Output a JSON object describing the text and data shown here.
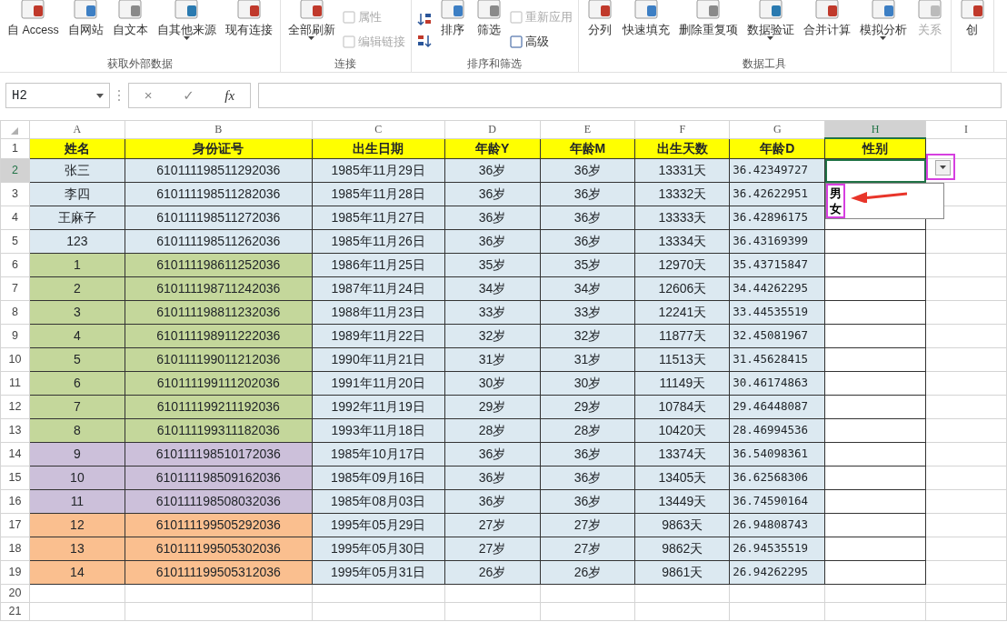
{
  "ribbon": {
    "groups": [
      {
        "label": "获取外部数据",
        "items": [
          {
            "kind": "large",
            "label": "自 Access",
            "dropdown": false,
            "disabled": false
          },
          {
            "kind": "large",
            "label": "自网站",
            "dropdown": false,
            "disabled": false
          },
          {
            "kind": "large",
            "label": "自文本",
            "dropdown": false,
            "disabled": false
          },
          {
            "kind": "large",
            "label": "自其他来源",
            "dropdown": true,
            "disabled": false
          },
          {
            "kind": "large",
            "label": "现有连接",
            "dropdown": false,
            "disabled": false
          }
        ]
      },
      {
        "label": "连接",
        "items": [
          {
            "kind": "large",
            "label": "全部刷新",
            "dropdown": true,
            "disabled": false
          },
          {
            "kind": "stack",
            "items": [
              {
                "label": "属性",
                "disabled": true
              },
              {
                "label": "编辑链接",
                "disabled": true
              }
            ]
          }
        ]
      },
      {
        "label": "排序和筛选",
        "items": [
          {
            "kind": "sort"
          },
          {
            "kind": "large",
            "label": "排序",
            "dropdown": false,
            "disabled": false
          },
          {
            "kind": "large",
            "label": "筛选",
            "dropdown": false,
            "disabled": false
          },
          {
            "kind": "stack",
            "items": [
              {
                "label": "重新应用",
                "disabled": true
              },
              {
                "label": "高级",
                "disabled": false
              }
            ]
          }
        ]
      },
      {
        "label": "数据工具",
        "items": [
          {
            "kind": "large",
            "label": "分列",
            "dropdown": false,
            "disabled": false
          },
          {
            "kind": "large",
            "label": "快速填充",
            "dropdown": false,
            "disabled": false
          },
          {
            "kind": "large",
            "label": "删除重复项",
            "dropdown": false,
            "disabled": false
          },
          {
            "kind": "large",
            "label": "数据验证",
            "dropdown": true,
            "disabled": false
          },
          {
            "kind": "large",
            "label": "合并计算",
            "dropdown": false,
            "disabled": false
          },
          {
            "kind": "large",
            "label": "模拟分析",
            "dropdown": true,
            "disabled": false
          },
          {
            "kind": "large",
            "label": "关系",
            "dropdown": false,
            "disabled": true
          }
        ]
      },
      {
        "items": [
          {
            "kind": "large",
            "label": "创",
            "dropdown": false,
            "disabled": false
          }
        ]
      }
    ]
  },
  "formula_bar": {
    "name_box": "H2",
    "buttons": [
      "×",
      "✓",
      "fx"
    ]
  },
  "sheet": {
    "columns": [
      {
        "label": "A",
        "selected": false
      },
      {
        "label": "B",
        "selected": false
      },
      {
        "label": "C",
        "selected": false
      },
      {
        "label": "D",
        "selected": false
      },
      {
        "label": "E",
        "selected": false
      },
      {
        "label": "F",
        "selected": false
      },
      {
        "label": "G",
        "selected": false
      },
      {
        "label": "H",
        "selected": true
      },
      {
        "label": "I",
        "selected": false
      }
    ],
    "header_row": {
      "number": "1",
      "cells": [
        "姓名",
        "身份证号",
        "出生日期",
        "年龄Y",
        "年龄M",
        "出生天数",
        "年龄D",
        "性别"
      ]
    },
    "rows": [
      {
        "number": "2",
        "selected": true,
        "color": "#dce9f1",
        "cells": [
          "张三",
          "610111198511292036",
          "1985年11月29日",
          "36岁",
          "36岁",
          "13331天",
          "36.42349727"
        ]
      },
      {
        "number": "3",
        "selected": false,
        "color": "#dce9f1",
        "cells": [
          "李四",
          "610111198511282036",
          "1985年11月28日",
          "36岁",
          "36岁",
          "13332天",
          "36.42622951"
        ]
      },
      {
        "number": "4",
        "selected": false,
        "color": "#dce9f1",
        "cells": [
          "王麻子",
          "610111198511272036",
          "1985年11月27日",
          "36岁",
          "36岁",
          "13333天",
          "36.42896175"
        ]
      },
      {
        "number": "5",
        "selected": false,
        "color": "#dce9f1",
        "cells": [
          "123",
          "610111198511262036",
          "1985年11月26日",
          "36岁",
          "36岁",
          "13334天",
          "36.43169399"
        ]
      },
      {
        "number": "6",
        "selected": false,
        "color": "#c4d79b",
        "cells": [
          "1",
          "610111198611252036",
          "1986年11月25日",
          "35岁",
          "35岁",
          "12970天",
          "35.43715847"
        ]
      },
      {
        "number": "7",
        "selected": false,
        "color": "#c4d79b",
        "cells": [
          "2",
          "610111198711242036",
          "1987年11月24日",
          "34岁",
          "34岁",
          "12606天",
          "34.44262295"
        ]
      },
      {
        "number": "8",
        "selected": false,
        "color": "#c4d79b",
        "cells": [
          "3",
          "610111198811232036",
          "1988年11月23日",
          "33岁",
          "33岁",
          "12241天",
          "33.44535519"
        ]
      },
      {
        "number": "9",
        "selected": false,
        "color": "#c4d79b",
        "cells": [
          "4",
          "610111198911222036",
          "1989年11月22日",
          "32岁",
          "32岁",
          "11877天",
          "32.45081967"
        ]
      },
      {
        "number": "10",
        "selected": false,
        "color": "#c4d79b",
        "cells": [
          "5",
          "610111199011212036",
          "1990年11月21日",
          "31岁",
          "31岁",
          "11513天",
          "31.45628415"
        ]
      },
      {
        "number": "11",
        "selected": false,
        "color": "#c4d79b",
        "cells": [
          "6",
          "610111199111202036",
          "1991年11月20日",
          "30岁",
          "30岁",
          "11149天",
          "30.46174863"
        ]
      },
      {
        "number": "12",
        "selected": false,
        "color": "#c4d79b",
        "cells": [
          "7",
          "610111199211192036",
          "1992年11月19日",
          "29岁",
          "29岁",
          "10784天",
          "29.46448087"
        ]
      },
      {
        "number": "13",
        "selected": false,
        "color": "#c4d79b",
        "cells": [
          "8",
          "610111199311182036",
          "1993年11月18日",
          "28岁",
          "28岁",
          "10420天",
          "28.46994536"
        ]
      },
      {
        "number": "14",
        "selected": false,
        "color": "#ccc0da",
        "cells": [
          "9",
          "610111198510172036",
          "1985年10月17日",
          "36岁",
          "36岁",
          "13374天",
          "36.54098361"
        ]
      },
      {
        "number": "15",
        "selected": false,
        "color": "#ccc0da",
        "cells": [
          "10",
          "610111198509162036",
          "1985年09月16日",
          "36岁",
          "36岁",
          "13405天",
          "36.62568306"
        ]
      },
      {
        "number": "16",
        "selected": false,
        "color": "#ccc0da",
        "cells": [
          "11",
          "610111198508032036",
          "1985年08月03日",
          "36岁",
          "36岁",
          "13449天",
          "36.74590164"
        ]
      },
      {
        "number": "17",
        "selected": false,
        "color": "#fabf8f",
        "cells": [
          "12",
          "610111199505292036",
          "1995年05月29日",
          "27岁",
          "27岁",
          "9863天",
          "26.94808743"
        ]
      },
      {
        "number": "18",
        "selected": false,
        "color": "#fabf8f",
        "cells": [
          "13",
          "610111199505302036",
          "1995年05月30日",
          "27岁",
          "27岁",
          "9862天",
          "26.94535519"
        ]
      },
      {
        "number": "19",
        "selected": false,
        "color": "#fabf8f",
        "cells": [
          "14",
          "610111199505312036",
          "1995年05月31日",
          "26岁",
          "26岁",
          "9861天",
          "26.94262295"
        ]
      },
      {
        "number": "20",
        "selected": false
      },
      {
        "number": "21",
        "selected": false
      }
    ],
    "dropdown": {
      "open": true,
      "options": [
        "男",
        "女"
      ]
    }
  }
}
